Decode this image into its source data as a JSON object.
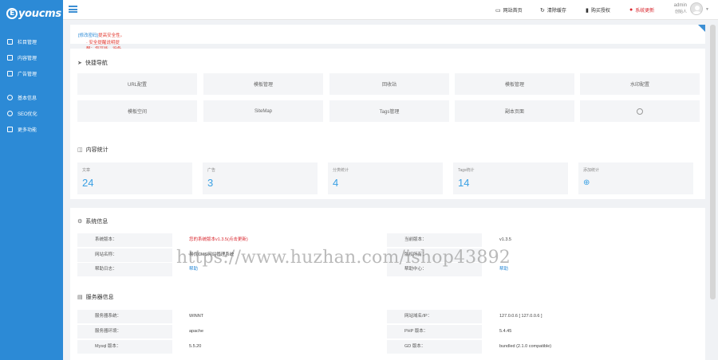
{
  "brand": {
    "logo_letter": "E",
    "logo_text": "youcms"
  },
  "sidebar": {
    "items": [
      {
        "label": "栏目管理",
        "icon": "folder-icon"
      },
      {
        "label": "内容管理",
        "icon": "document-icon"
      },
      {
        "label": "广告管理",
        "icon": "image-icon"
      },
      {
        "label": "基本信息",
        "icon": "gear-icon"
      },
      {
        "label": "SEO优化",
        "icon": "target-icon"
      },
      {
        "label": "更多功能",
        "icon": "grid-icon"
      }
    ]
  },
  "topbar": {
    "links": [
      {
        "label": "网站首页",
        "icon": "monitor-icon"
      },
      {
        "label": "清除缓存",
        "icon": "refresh-icon"
      },
      {
        "label": "购买授权",
        "icon": "bookmark-icon"
      },
      {
        "label": "系统更新",
        "icon": "alert-icon"
      }
    ],
    "user": {
      "name": "admin",
      "role": "创始人"
    },
    "colors": {
      "update": "#d9272e"
    }
  },
  "notice": {
    "text": "· 安全提醒说明提醒：您可能、设备出现或被、请及时",
    "link": "[修改密码]",
    "tail": "提高安全性。"
  },
  "quick_nav": {
    "title": "快捷导航",
    "items": [
      "URL配置",
      "模板管理",
      "回收站",
      "模板管理",
      "水印配置",
      "模板空间",
      "SiteMap",
      "Tags管理",
      "副本页面",
      "+"
    ]
  },
  "content_stats": {
    "title": "内容统计",
    "items": [
      {
        "label": "文章",
        "value": "24"
      },
      {
        "label": "广告",
        "value": "3"
      },
      {
        "label": "分类统计",
        "value": "4"
      },
      {
        "label": "Tags统计",
        "value": "14"
      },
      {
        "label": "添加统计",
        "value": "⊕"
      }
    ]
  },
  "system_info": {
    "title": "系统信息",
    "rows": [
      {
        "k1": "系统版本：",
        "v1": "您的系统版本v1.3.5(点击更新)",
        "k2": "当前版本：",
        "v2": "v1.3.5"
      },
      {
        "k1": "网站名称：",
        "v1": "易优CMS网站管理系统",
        "k2": "版权所有：",
        "v2": ""
      },
      {
        "k1": "帮助日志：",
        "v1": "帮助",
        "k2": "帮助中心：",
        "v2": "帮助"
      }
    ]
  },
  "server_info": {
    "title": "服务器信息",
    "rows": [
      {
        "k1": "服务器系统：",
        "v1": "WINNT",
        "k2": "网站域名/IP：",
        "v2": "127.0.0.6 [ 127.0.0.6 ]"
      },
      {
        "k1": "服务器环境：",
        "v1": "apache",
        "k2": "PHP 版本：",
        "v2": "5.4.45"
      },
      {
        "k1": "Mysql 版本：",
        "v1": "5.5.20",
        "k2": "GD 版本：",
        "v2": "bundled (2.1.0 compatible)"
      }
    ]
  },
  "watermark": "https://www.huzhan.com/ishop43892"
}
